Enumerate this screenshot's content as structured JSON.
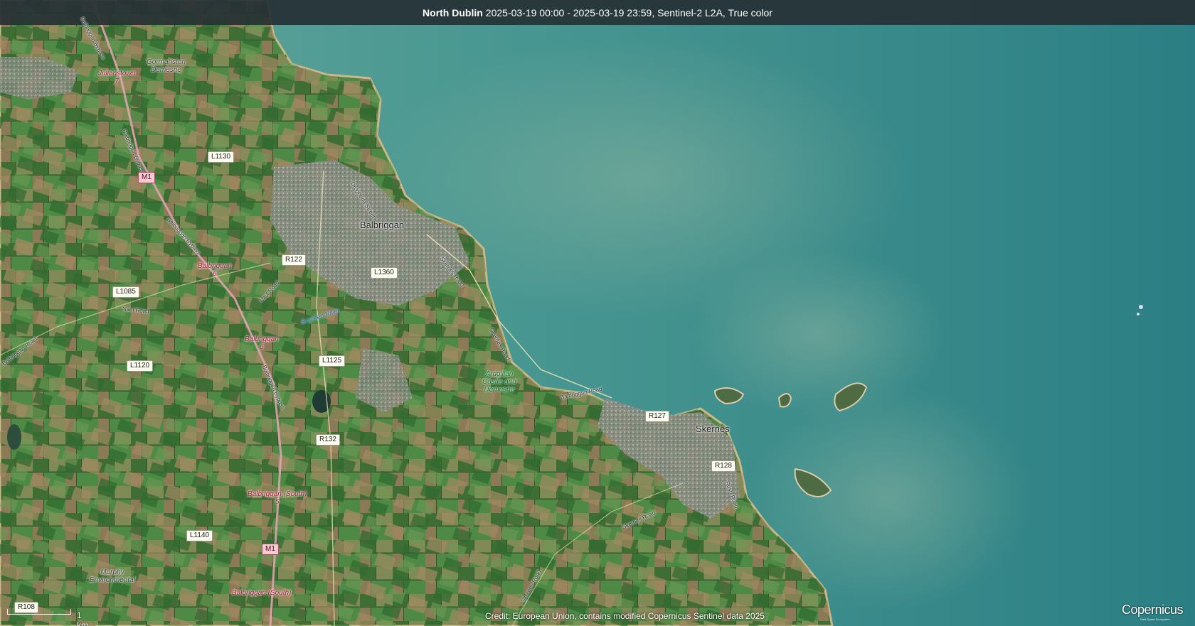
{
  "header": {
    "location": "North Dublin",
    "details": "2025-03-19 00:00 - 2025-03-19 23:59, Sentinel-2 L2A, True color"
  },
  "towns": [
    {
      "id": "balbriggan",
      "name": "Balbriggan"
    },
    {
      "id": "skerries",
      "name": "Skerries"
    }
  ],
  "places": {
    "julianstown": "Julianstown",
    "julianstown_num": "7",
    "gormanston": "Gormanston",
    "gormanston2": "Demesne",
    "balbriggan6a": "Balbriggan",
    "balbriggan6a_num": "6",
    "balbriggan6b": "Balbriggan",
    "balbriggan6b_num": "6",
    "balbriggan_south1": "Balbriggan (South)",
    "balbriggan_south1_num": "5",
    "balbriggan_south2": "Balbriggan (South)",
    "ardgillan1": "Ardgillan",
    "ardgillan2": "Castle and",
    "ardgillan3": "Demesne",
    "murphy1": "Murphy",
    "murphy2": "Environmental"
  },
  "streets": {
    "drogheda": "Drogheda Street",
    "skerries_road1": "Skerries Road",
    "skerries_road2": "Skerries Road",
    "skerries_road3": "Skerries Road",
    "skerries_road4": "Skerries Road",
    "naul_road1": "Naul Road",
    "naul_road2": "Naul Road",
    "balbriggan_road": "Balbriggan Road",
    "balbriggan_road2": "Balbriggan Road",
    "bypass1": "Balbriggan Bypass",
    "bypass2": "Balbriggan Bypass",
    "bypass3": "Balbriggan Bypass",
    "bypass4": "Balbriggan Bypass",
    "rush_road": "Rush Road",
    "bracken": "Bracken River"
  },
  "shields": {
    "l1130": "L1130",
    "m1a": "M1",
    "r122": "R122",
    "l1360": "L1360",
    "l1085": "L1085",
    "l1125": "L1125",
    "l1120": "L1120",
    "r132": "R132",
    "r127": "R127",
    "r128": "R128",
    "l1140": "L1140",
    "m1b": "M1",
    "r108": "R108"
  },
  "scale": {
    "label": "1 km"
  },
  "credit": "Credit: European Union, contains modified Copernicus Sentinel data 2025",
  "logo": {
    "name": "Copernicus",
    "tagline": "Data Space Ecosystem"
  },
  "colors": {
    "sea": "#3f8f8c",
    "land": "#5a7a45",
    "urban": "#8d8f86",
    "title_bg": "#263034"
  }
}
